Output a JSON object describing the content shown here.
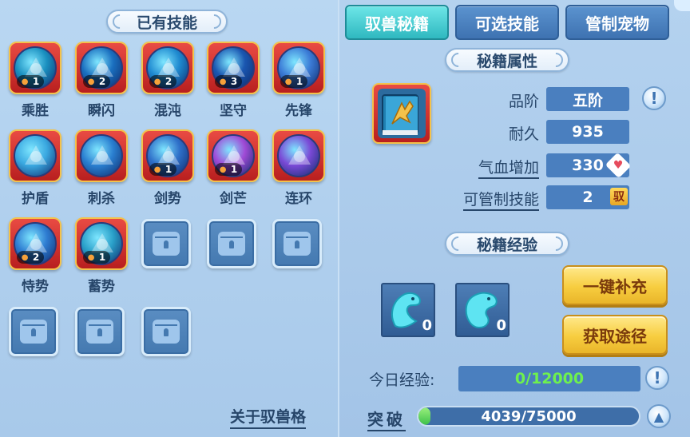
{
  "left_panel": {
    "title": "已有技能",
    "skills": [
      {
        "name": "乘胜",
        "count": "1",
        "color": "#1a8fbf"
      },
      {
        "name": "瞬闪",
        "count": "2",
        "color": "#1a6fbf"
      },
      {
        "name": "混沌",
        "count": "2",
        "color": "#1f8ad0"
      },
      {
        "name": "坚守",
        "count": "3",
        "color": "#1a56b0"
      },
      {
        "name": "先锋",
        "count": "1",
        "color": "#3b7bd6"
      },
      {
        "name": "护盾",
        "count": "",
        "color": "#3aa8e0"
      },
      {
        "name": "刺杀",
        "count": "",
        "color": "#2a7fd0"
      },
      {
        "name": "剑势",
        "count": "1",
        "color": "#2f70c9"
      },
      {
        "name": "剑芒",
        "count": "1",
        "color": "#a04ad6"
      },
      {
        "name": "连环",
        "count": "",
        "color": "#7a4ad6"
      },
      {
        "name": "恃势",
        "count": "2",
        "color": "#2e7cd1"
      },
      {
        "name": "蓄势",
        "count": "1",
        "color": "#2aa0c9"
      }
    ],
    "about_link": "关于驭兽格"
  },
  "tabs": [
    {
      "label": "驭兽秘籍",
      "active": true
    },
    {
      "label": "可选技能",
      "active": false
    },
    {
      "label": "管制宠物",
      "active": false
    }
  ],
  "attributes": {
    "title": "秘籍属性",
    "rows": [
      {
        "label": "品阶",
        "value": "五阶"
      },
      {
        "label": "耐久",
        "value": "935"
      },
      {
        "label": "气血增加",
        "value": "330"
      },
      {
        "label": "可管制技能",
        "value": "2"
      }
    ],
    "yu_badge": "驭"
  },
  "experience": {
    "title": "秘籍经验",
    "items": [
      {
        "qty": "0"
      },
      {
        "qty": "0"
      }
    ],
    "refill_button": "一键补充",
    "obtain_button": "获取途径",
    "today_label": "今日经验:",
    "today_value": "0/12000",
    "break_label": "突破",
    "break_value": "4039/75000",
    "break_progress": 0.0539
  }
}
